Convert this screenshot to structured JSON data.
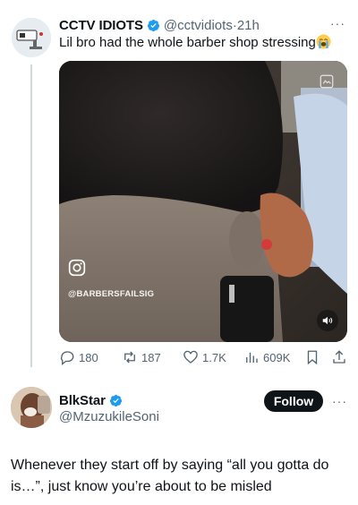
{
  "tweet": {
    "author_name": "CCTV IDIOTS",
    "handle": "@cctvidiots",
    "separator": "·",
    "time": "21h",
    "more": "···",
    "text": "Lil bro had the whole barber shop stressing",
    "emoji": "loudly-crying-face",
    "media": {
      "watermark": "@BARBERSFAILSIG",
      "icons": [
        "instagram-icon",
        "media-top-right-icon",
        "volume-icon"
      ]
    },
    "stats": {
      "replies": "180",
      "reposts": "187",
      "likes": "1.7K",
      "views": "609K"
    }
  },
  "reply": {
    "author_name": "BlkStar",
    "handle": "@MzuzukileSoni",
    "follow_label": "Follow",
    "more": "···",
    "text": "Whenever they start off by saying “all you gotta do is…”, just know you’re about to be misled"
  },
  "colors": {
    "verified": "#1d9bf0",
    "secondary_text": "#536471",
    "follow_button": "#0f1419",
    "thread_line": "#cfd9de"
  }
}
